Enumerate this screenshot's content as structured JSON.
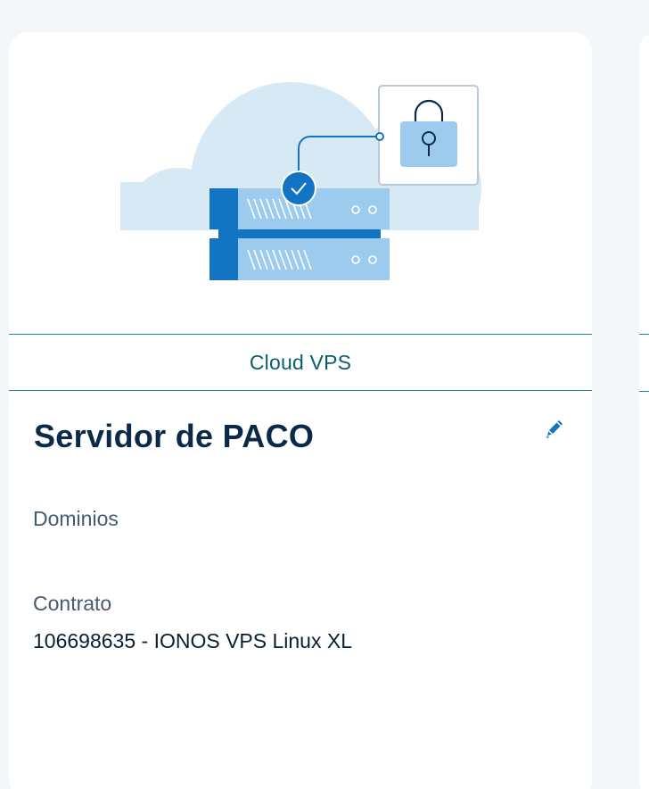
{
  "card": {
    "category": "Cloud VPS",
    "server_name": "Servidor de PACO",
    "domains_label": "Dominios",
    "contract_label": "Contrato",
    "contract_value": "106698635 - IONOS VPS Linux XL"
  },
  "icons": {
    "edit": "pencil-icon",
    "illustration": "cloud-server-lock-illustration"
  },
  "colors": {
    "page_background": "#f4f7fa",
    "card_background": "#ffffff",
    "divider": "#1a8a96",
    "category_text": "#0b5d6b",
    "title_text": "#0b2a4a",
    "label_text": "#465a70",
    "accent_blue": "#1474c4"
  }
}
